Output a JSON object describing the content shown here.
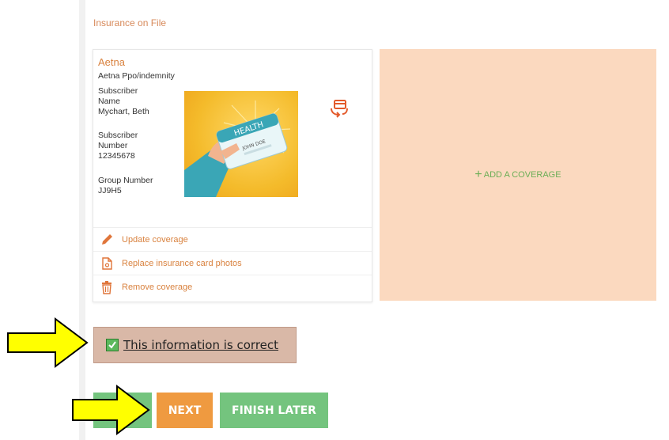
{
  "section": {
    "title": "Insurance on File"
  },
  "coverage": {
    "name": "Aetna",
    "plan": "Aetna Ppo/indemnity",
    "subscriber_name_label_1": "Subscriber",
    "subscriber_name_label_2": "Name",
    "subscriber_name": "Mychart, Beth",
    "subscriber_number_label_1": "Subscriber",
    "subscriber_number_label_2": "Number",
    "subscriber_number": "12345678",
    "group_number_label": "Group Number",
    "group_number": "JJ9H5",
    "card_text_1": "HEALTH",
    "card_text_2": "JOHN DOE"
  },
  "actions": {
    "update": "Update coverage",
    "replace": "Replace insurance card photos",
    "remove": "Remove coverage"
  },
  "add_coverage": {
    "label": "ADD A COVERAGE"
  },
  "confirm": {
    "label": "This information is correct",
    "checked": true
  },
  "buttons": {
    "next": "NEXT",
    "finish_later": "FINISH LATER"
  },
  "colors": {
    "accent": "#d9823f",
    "add_panel": "#fbd9bf",
    "green": "#74c47e",
    "orange": "#ef9a40",
    "arrow": "#ffff00"
  },
  "icons": [
    "swap-card-icon",
    "pencil-icon",
    "document-icon",
    "trash-icon",
    "plus-icon",
    "checkmark-icon",
    "arrow-annotation"
  ]
}
